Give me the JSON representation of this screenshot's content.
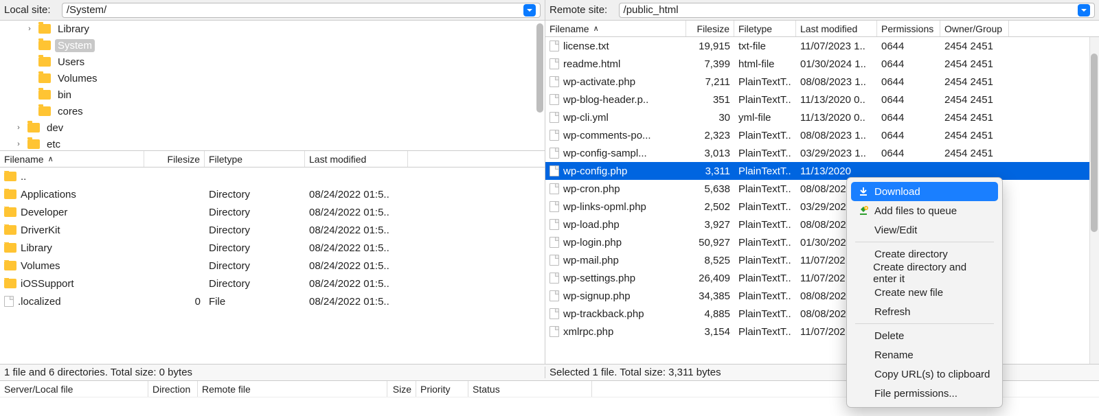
{
  "local": {
    "label": "Local site:  ",
    "path": "/System/",
    "tree": [
      {
        "indent": 36,
        "disclosure": "›",
        "name": "Library",
        "selected": false
      },
      {
        "indent": 36,
        "disclosure": "",
        "name": "System",
        "selected": true
      },
      {
        "indent": 36,
        "disclosure": "",
        "name": "Users",
        "selected": false
      },
      {
        "indent": 36,
        "disclosure": "",
        "name": "Volumes",
        "selected": false
      },
      {
        "indent": 36,
        "disclosure": "",
        "name": "bin",
        "selected": false
      },
      {
        "indent": 36,
        "disclosure": "",
        "name": "cores",
        "selected": false
      },
      {
        "indent": 20,
        "disclosure": "›",
        "name": "dev",
        "selected": false
      },
      {
        "indent": 20,
        "disclosure": "›",
        "name": "etc",
        "selected": false
      }
    ],
    "columns": {
      "name": "Filename",
      "size": "Filesize",
      "type": "Filetype",
      "modified": "Last modified"
    },
    "files": [
      {
        "icon": "folder",
        "name": "..",
        "size": "",
        "type": "",
        "modified": ""
      },
      {
        "icon": "folder",
        "name": "Applications",
        "size": "",
        "type": "Directory",
        "modified": "08/24/2022 01:5.."
      },
      {
        "icon": "folder",
        "name": "Developer",
        "size": "",
        "type": "Directory",
        "modified": "08/24/2022 01:5.."
      },
      {
        "icon": "folder",
        "name": "DriverKit",
        "size": "",
        "type": "Directory",
        "modified": "08/24/2022 01:5.."
      },
      {
        "icon": "folder",
        "name": "Library",
        "size": "",
        "type": "Directory",
        "modified": "08/24/2022 01:5.."
      },
      {
        "icon": "folder",
        "name": "Volumes",
        "size": "",
        "type": "Directory",
        "modified": "08/24/2022 01:5.."
      },
      {
        "icon": "folder",
        "name": "iOSSupport",
        "size": "",
        "type": "Directory",
        "modified": "08/24/2022 01:5.."
      },
      {
        "icon": "file",
        "name": ".localized",
        "size": "0",
        "type": "File",
        "modified": "08/24/2022 01:5.."
      }
    ],
    "status": "1 file and 6 directories. Total size: 0 bytes"
  },
  "remote": {
    "label": "Remote site:  ",
    "path": "/public_html",
    "columns": {
      "name": "Filename",
      "size": "Filesize",
      "type": "Filetype",
      "modified": "Last modified",
      "perm": "Permissions",
      "owner": "Owner/Group"
    },
    "files": [
      {
        "name": "license.txt",
        "size": "19,915",
        "type": "txt-file",
        "modified": "11/07/2023 1..",
        "perm": "0644",
        "owner": "2454 2451",
        "selected": false
      },
      {
        "name": "readme.html",
        "size": "7,399",
        "type": "html-file",
        "modified": "01/30/2024 1..",
        "perm": "0644",
        "owner": "2454 2451",
        "selected": false
      },
      {
        "name": "wp-activate.php",
        "size": "7,211",
        "type": "PlainTextT..",
        "modified": "08/08/2023 1..",
        "perm": "0644",
        "owner": "2454 2451",
        "selected": false
      },
      {
        "name": "wp-blog-header.p..",
        "size": "351",
        "type": "PlainTextT..",
        "modified": "11/13/2020 0..",
        "perm": "0644",
        "owner": "2454 2451",
        "selected": false
      },
      {
        "name": "wp-cli.yml",
        "size": "30",
        "type": "yml-file",
        "modified": "11/13/2020 0..",
        "perm": "0644",
        "owner": "2454 2451",
        "selected": false
      },
      {
        "name": "wp-comments-po...",
        "size": "2,323",
        "type": "PlainTextT..",
        "modified": "08/08/2023 1..",
        "perm": "0644",
        "owner": "2454 2451",
        "selected": false
      },
      {
        "name": "wp-config-sampl...",
        "size": "3,013",
        "type": "PlainTextT..",
        "modified": "03/29/2023 1..",
        "perm": "0644",
        "owner": "2454 2451",
        "selected": false
      },
      {
        "name": "wp-config.php",
        "size": "3,311",
        "type": "PlainTextT..",
        "modified": "11/13/2020",
        "perm": "",
        "owner": "",
        "selected": true
      },
      {
        "name": "wp-cron.php",
        "size": "5,638",
        "type": "PlainTextT..",
        "modified": "08/08/202",
        "perm": "",
        "owner": "",
        "selected": false
      },
      {
        "name": "wp-links-opml.php",
        "size": "2,502",
        "type": "PlainTextT..",
        "modified": "03/29/202",
        "perm": "",
        "owner": "",
        "selected": false
      },
      {
        "name": "wp-load.php",
        "size": "3,927",
        "type": "PlainTextT..",
        "modified": "08/08/202",
        "perm": "",
        "owner": "",
        "selected": false
      },
      {
        "name": "wp-login.php",
        "size": "50,927",
        "type": "PlainTextT..",
        "modified": "01/30/202",
        "perm": "",
        "owner": "",
        "selected": false
      },
      {
        "name": "wp-mail.php",
        "size": "8,525",
        "type": "PlainTextT..",
        "modified": "11/07/202",
        "perm": "",
        "owner": "",
        "selected": false
      },
      {
        "name": "wp-settings.php",
        "size": "26,409",
        "type": "PlainTextT..",
        "modified": "11/07/202",
        "perm": "",
        "owner": "",
        "selected": false
      },
      {
        "name": "wp-signup.php",
        "size": "34,385",
        "type": "PlainTextT..",
        "modified": "08/08/202",
        "perm": "",
        "owner": "",
        "selected": false
      },
      {
        "name": "wp-trackback.php",
        "size": "4,885",
        "type": "PlainTextT..",
        "modified": "08/08/202",
        "perm": "",
        "owner": "",
        "selected": false
      },
      {
        "name": "xmlrpc.php",
        "size": "3,154",
        "type": "PlainTextT..",
        "modified": "11/07/202",
        "perm": "",
        "owner": "",
        "selected": false
      }
    ],
    "status": "Selected 1 file. Total size: 3,311 bytes"
  },
  "context_menu": {
    "download": "Download",
    "add_queue": "Add files to queue",
    "view_edit": "View/Edit",
    "create_dir": "Create directory",
    "create_dir_enter": "Create directory and enter it",
    "create_file": "Create new file",
    "refresh": "Refresh",
    "delete": "Delete",
    "rename": "Rename",
    "copy_url": "Copy URL(s) to clipboard",
    "file_perms": "File permissions..."
  },
  "queue": {
    "file": "Server/Local file",
    "direction": "Direction",
    "remote": "Remote file",
    "size": "Size",
    "priority": "Priority",
    "status": "Status"
  }
}
